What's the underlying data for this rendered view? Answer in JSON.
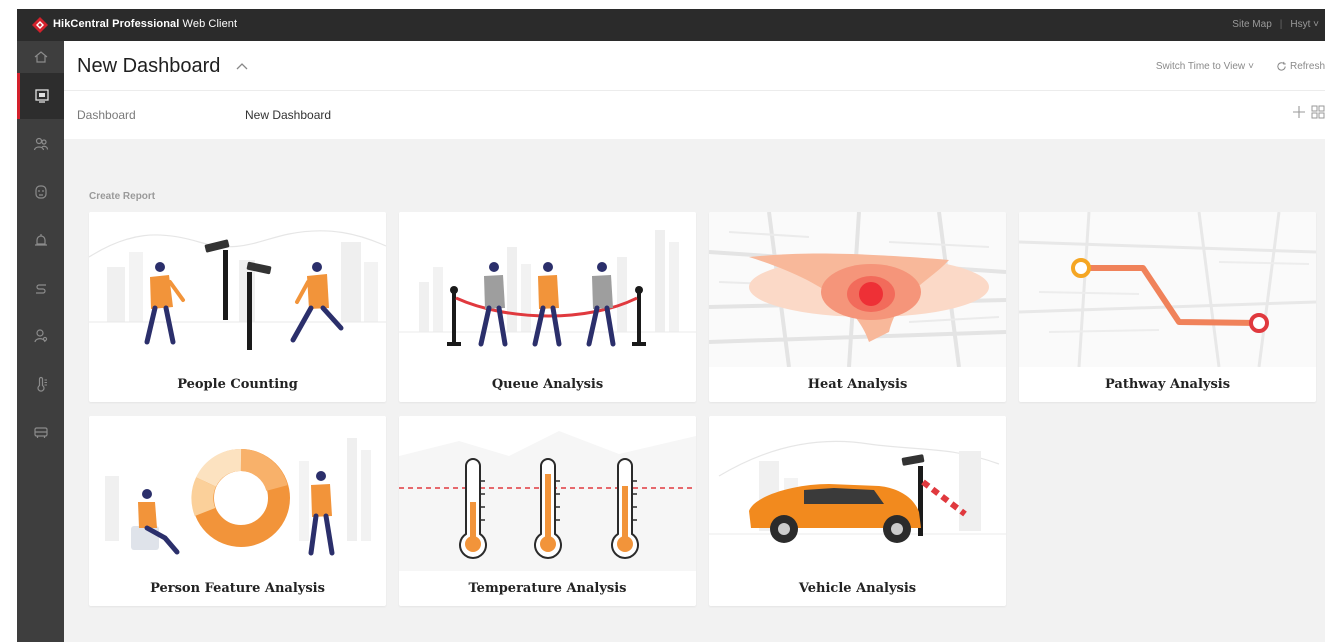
{
  "app": {
    "title_bold": "HikCentral Professional",
    "title_rest": " Web Client",
    "site_map": "Site Map",
    "user": "Hsyt"
  },
  "header": {
    "title": "New Dashboard",
    "switch_time": "Switch Time to View",
    "refresh": "Refresh"
  },
  "breadcrumb": {
    "root": "Dashboard",
    "current": "New Dashboard"
  },
  "section": {
    "label": "Create Report"
  },
  "cards": [
    {
      "label": "People Counting"
    },
    {
      "label": "Queue Analysis"
    },
    {
      "label": "Heat Analysis"
    },
    {
      "label": "Pathway Analysis"
    },
    {
      "label": "Person Feature Analysis"
    },
    {
      "label": "Temperature Analysis"
    },
    {
      "label": "Vehicle Analysis"
    }
  ],
  "rail": [
    "home-icon",
    "dashboard-icon",
    "people-icon",
    "face-icon",
    "alarm-icon",
    "pathway-icon",
    "person-icon",
    "temperature-icon",
    "vehicle-icon"
  ],
  "colors": {
    "accent": "#d3212c",
    "orange": "#f2943a",
    "navy": "#2b2f6b",
    "rail": "#3e3e3e",
    "topbar": "#2b2b2b"
  }
}
